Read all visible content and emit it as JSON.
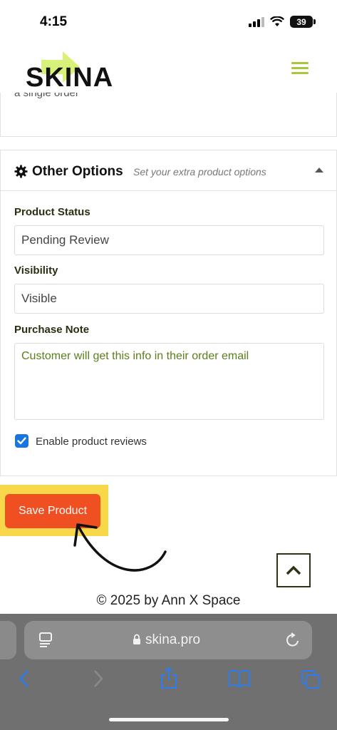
{
  "status_bar": {
    "time": "4:15",
    "battery": "39"
  },
  "header": {
    "logo_text": "SKINA"
  },
  "prev_panel": {
    "text": "a single order"
  },
  "other_options": {
    "title": "Other Options",
    "subtitle": "Set your extra product options",
    "product_status_label": "Product Status",
    "product_status_value": "Pending Review",
    "visibility_label": "Visibility",
    "visibility_value": "Visible",
    "purchase_note_label": "Purchase Note",
    "purchase_note_value": "Customer will get this info in their order email",
    "reviews_label": "Enable product reviews",
    "reviews_checked": true
  },
  "save_button_label": "Save Product",
  "footer": {
    "copyright": "© 2025 by Ann X Space"
  },
  "browser": {
    "url": "skina.pro"
  },
  "colors": {
    "accent": "#a8c83a",
    "save": "#f04f22",
    "highlight": "#f8d84a",
    "checkbox": "#1976e0"
  }
}
